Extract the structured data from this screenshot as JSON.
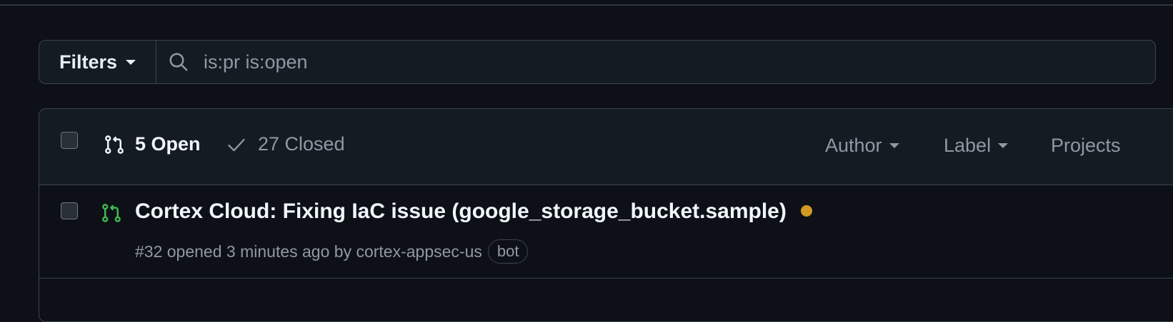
{
  "filters": {
    "label": "Filters"
  },
  "search": {
    "value": "is:pr is:open"
  },
  "list_header": {
    "open_label": "5 Open",
    "closed_label": "27 Closed",
    "author_label": "Author",
    "label_label": "Label",
    "projects_label": "Projects"
  },
  "pull_requests": [
    {
      "title": "Cortex Cloud: Fixing IaC issue (google_storage_bucket.sample)",
      "meta": "#32 opened 3 minutes ago by cortex-appsec-us",
      "badge": "bot",
      "status_color": "#d29922",
      "icon_color": "#3fb950"
    }
  ],
  "colors": {
    "background": "#0d1117",
    "header_bg": "#151b23",
    "border": "#3d444d",
    "open_icon": "#3fb950",
    "pending_dot": "#d29922"
  },
  "icons": {
    "filters_caret": "chevron-down-icon",
    "search": "search-icon",
    "open_pr": "git-pull-request-icon",
    "closed": "check-icon"
  }
}
